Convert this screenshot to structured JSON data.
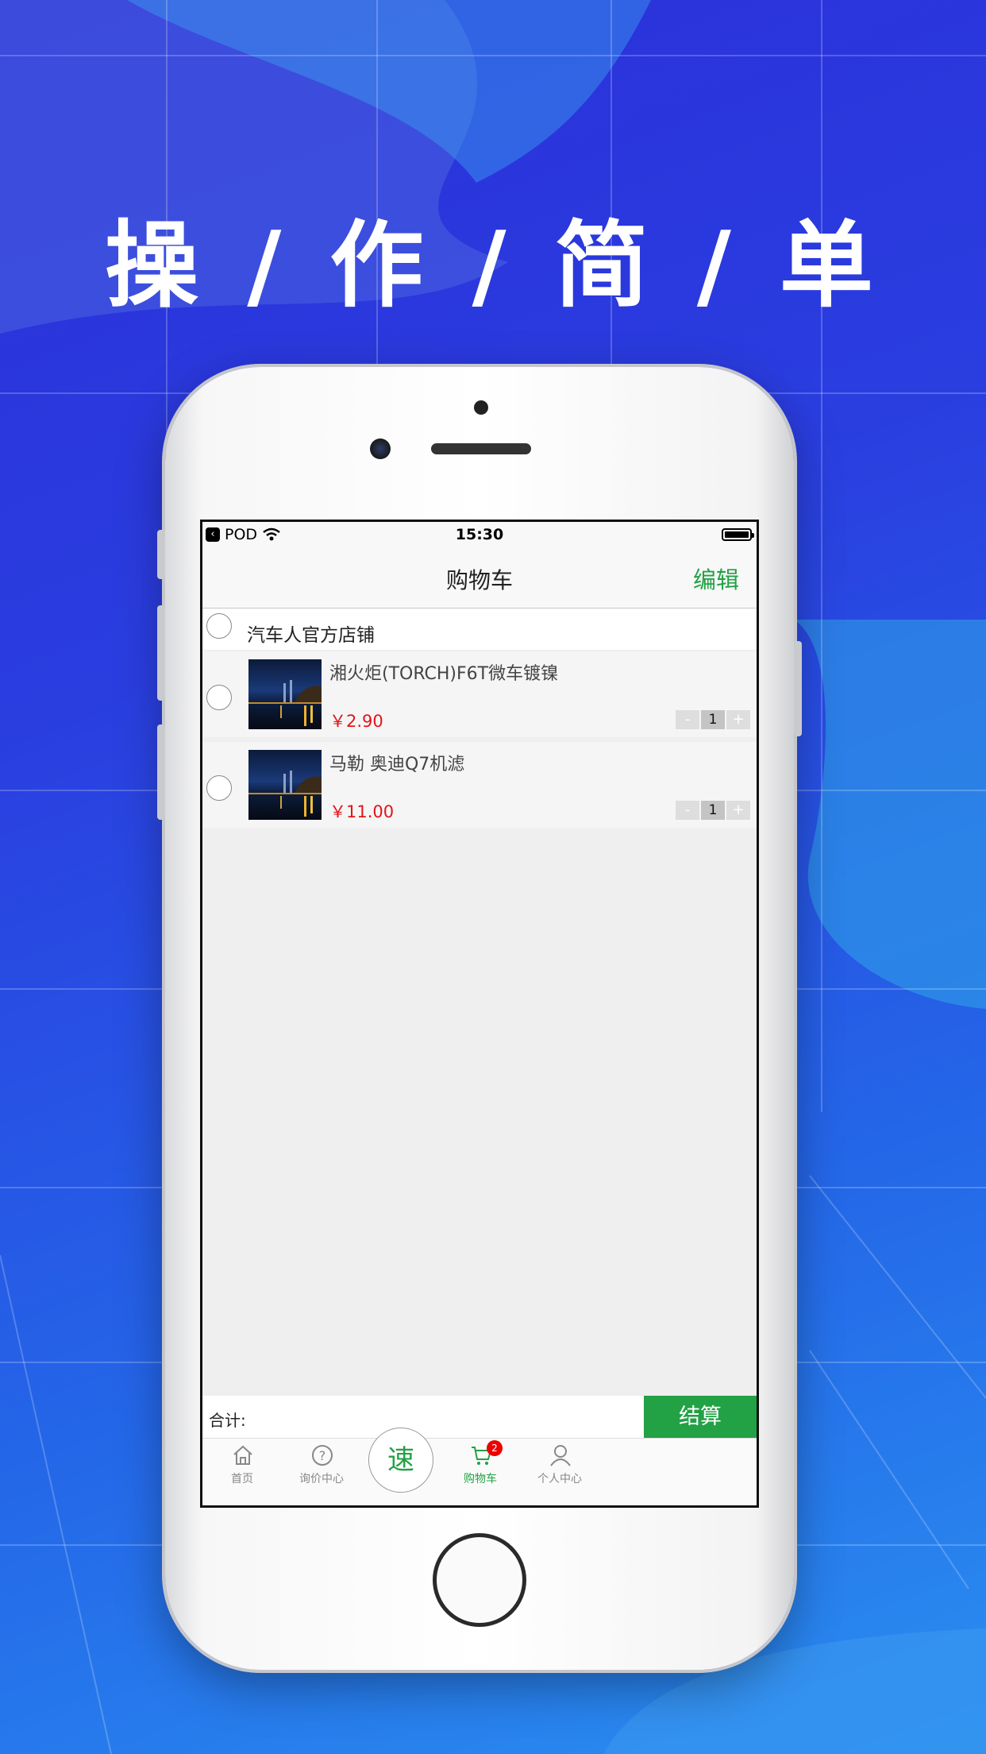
{
  "headline": "操 / 作 / 简 / 单",
  "status_bar": {
    "carrier": "POD",
    "time": "15:30"
  },
  "nav": {
    "title": "购物车",
    "edit_label": "编辑"
  },
  "store": {
    "name": "汽车人官方店铺"
  },
  "items": [
    {
      "title": "湘火炬(TORCH)F6T微车镀镍",
      "price": "￥2.90",
      "qty": "1",
      "minus": "-",
      "plus": "+"
    },
    {
      "title": "马勒 奥迪Q7机滤",
      "price": "￥11.00",
      "qty": "1",
      "minus": "-",
      "plus": "+"
    }
  ],
  "checkout": {
    "total_label": "合计:",
    "button_label": "结算"
  },
  "tabs": [
    {
      "label": "首页",
      "icon": "home-icon"
    },
    {
      "label": "询价中心",
      "icon": "question-icon"
    },
    {
      "label": "速",
      "icon": "speed-button"
    },
    {
      "label": "购物车",
      "icon": "cart-icon",
      "badge": "2",
      "active": true
    },
    {
      "label": "个人中心",
      "icon": "user-icon"
    }
  ],
  "colors": {
    "accent": "#22a145",
    "price": "#e4141a",
    "badge": "#ee0000"
  }
}
